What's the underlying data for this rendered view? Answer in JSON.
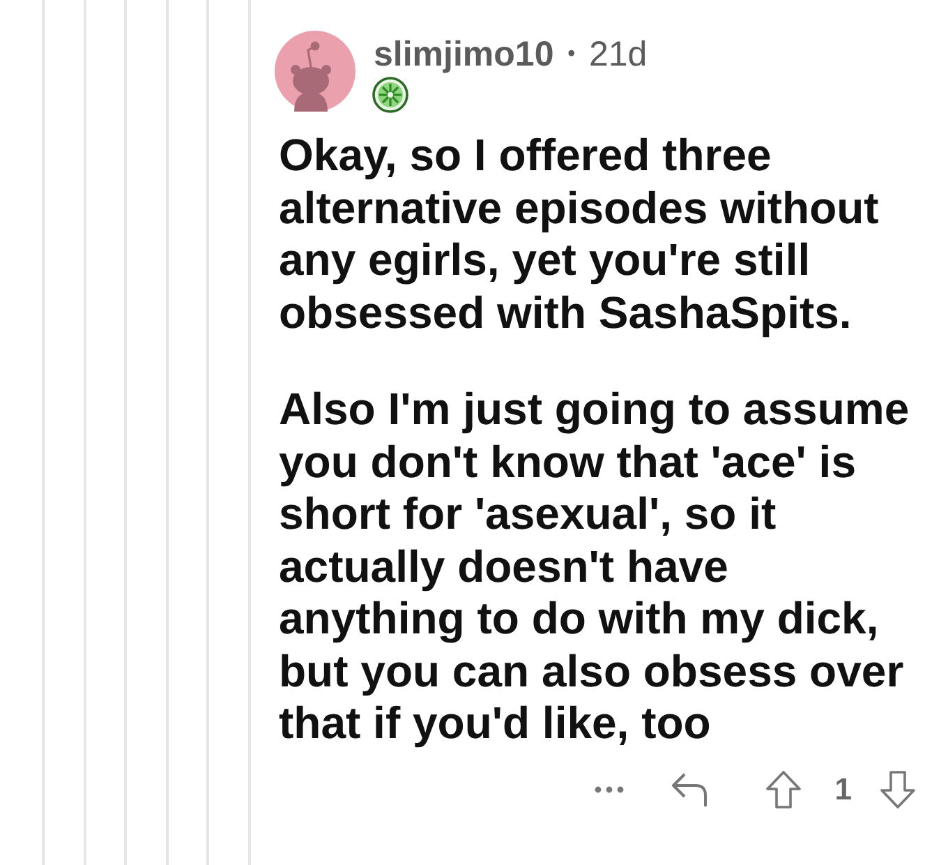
{
  "comment": {
    "author": "slimjimo10",
    "separator": "•",
    "age": "21d",
    "paragraphs": [
      "Okay, so I offered three alternative episodes without any egirls, yet you're still obsessed with SashaSpits.",
      "Also I'm just going to assume you don't know that 'ace' is short for 'asexual', so it actually doesn't have anything to do with my dick, but you can also obsess over that if you'd like, too"
    ],
    "score": "1"
  }
}
